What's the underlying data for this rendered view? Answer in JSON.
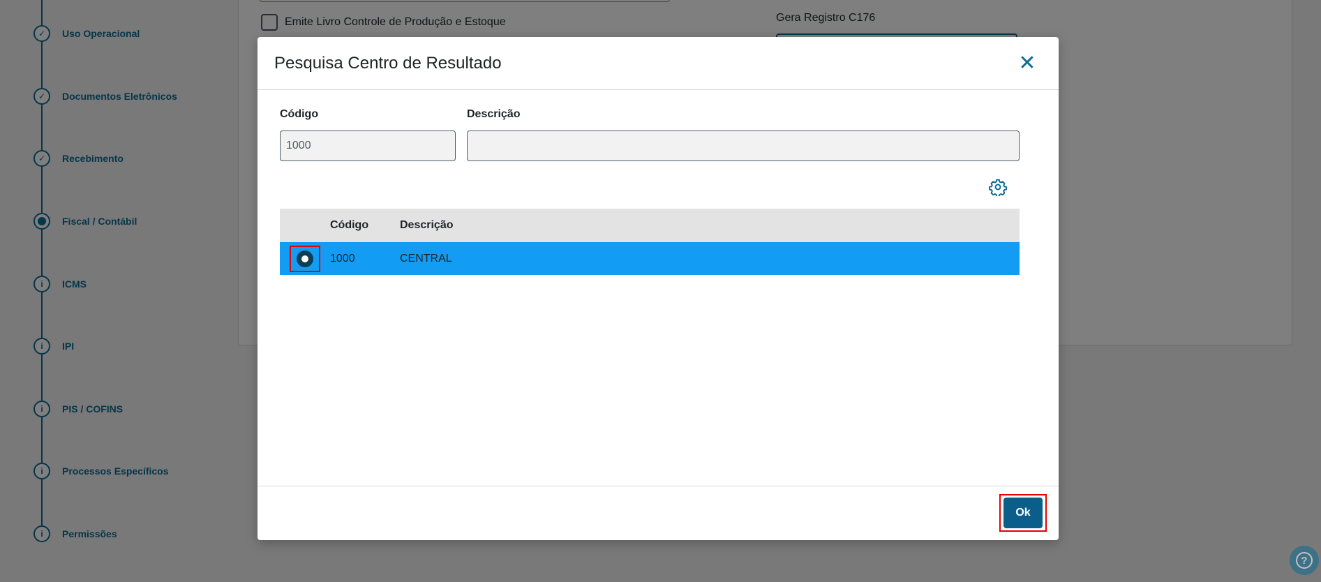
{
  "background": {
    "stepper": [
      {
        "label": "Uso Operacional",
        "state": "done"
      },
      {
        "label": "Documentos Eletrônicos",
        "state": "done"
      },
      {
        "label": "Recebimento",
        "state": "done"
      },
      {
        "label": "Fiscal / Contábil",
        "state": "active"
      },
      {
        "label": "ICMS",
        "state": "info"
      },
      {
        "label": "IPI",
        "state": "info"
      },
      {
        "label": "PIS / COFINS",
        "state": "info"
      },
      {
        "label": "Processos Específicos",
        "state": "info"
      },
      {
        "label": "Permissões",
        "state": "info"
      }
    ],
    "checkbox_label": "Emite Livro Controle de Produção e Estoque",
    "c176_label": "Gera Registro C176"
  },
  "modal": {
    "title": "Pesquisa Centro de Resultado",
    "filters": {
      "codigo_label": "Código",
      "codigo_value": "1000",
      "descricao_label": "Descrição",
      "descricao_value": ""
    },
    "table": {
      "columns": [
        "Código",
        "Descrição"
      ],
      "rows": [
        {
          "codigo": "1000",
          "descricao": "CENTRAL",
          "selected": true
        }
      ]
    },
    "ok_label": "Ok"
  },
  "colors": {
    "primary": "#0c6c94",
    "selected_row": "#139cf4",
    "highlight": "#e60000"
  }
}
